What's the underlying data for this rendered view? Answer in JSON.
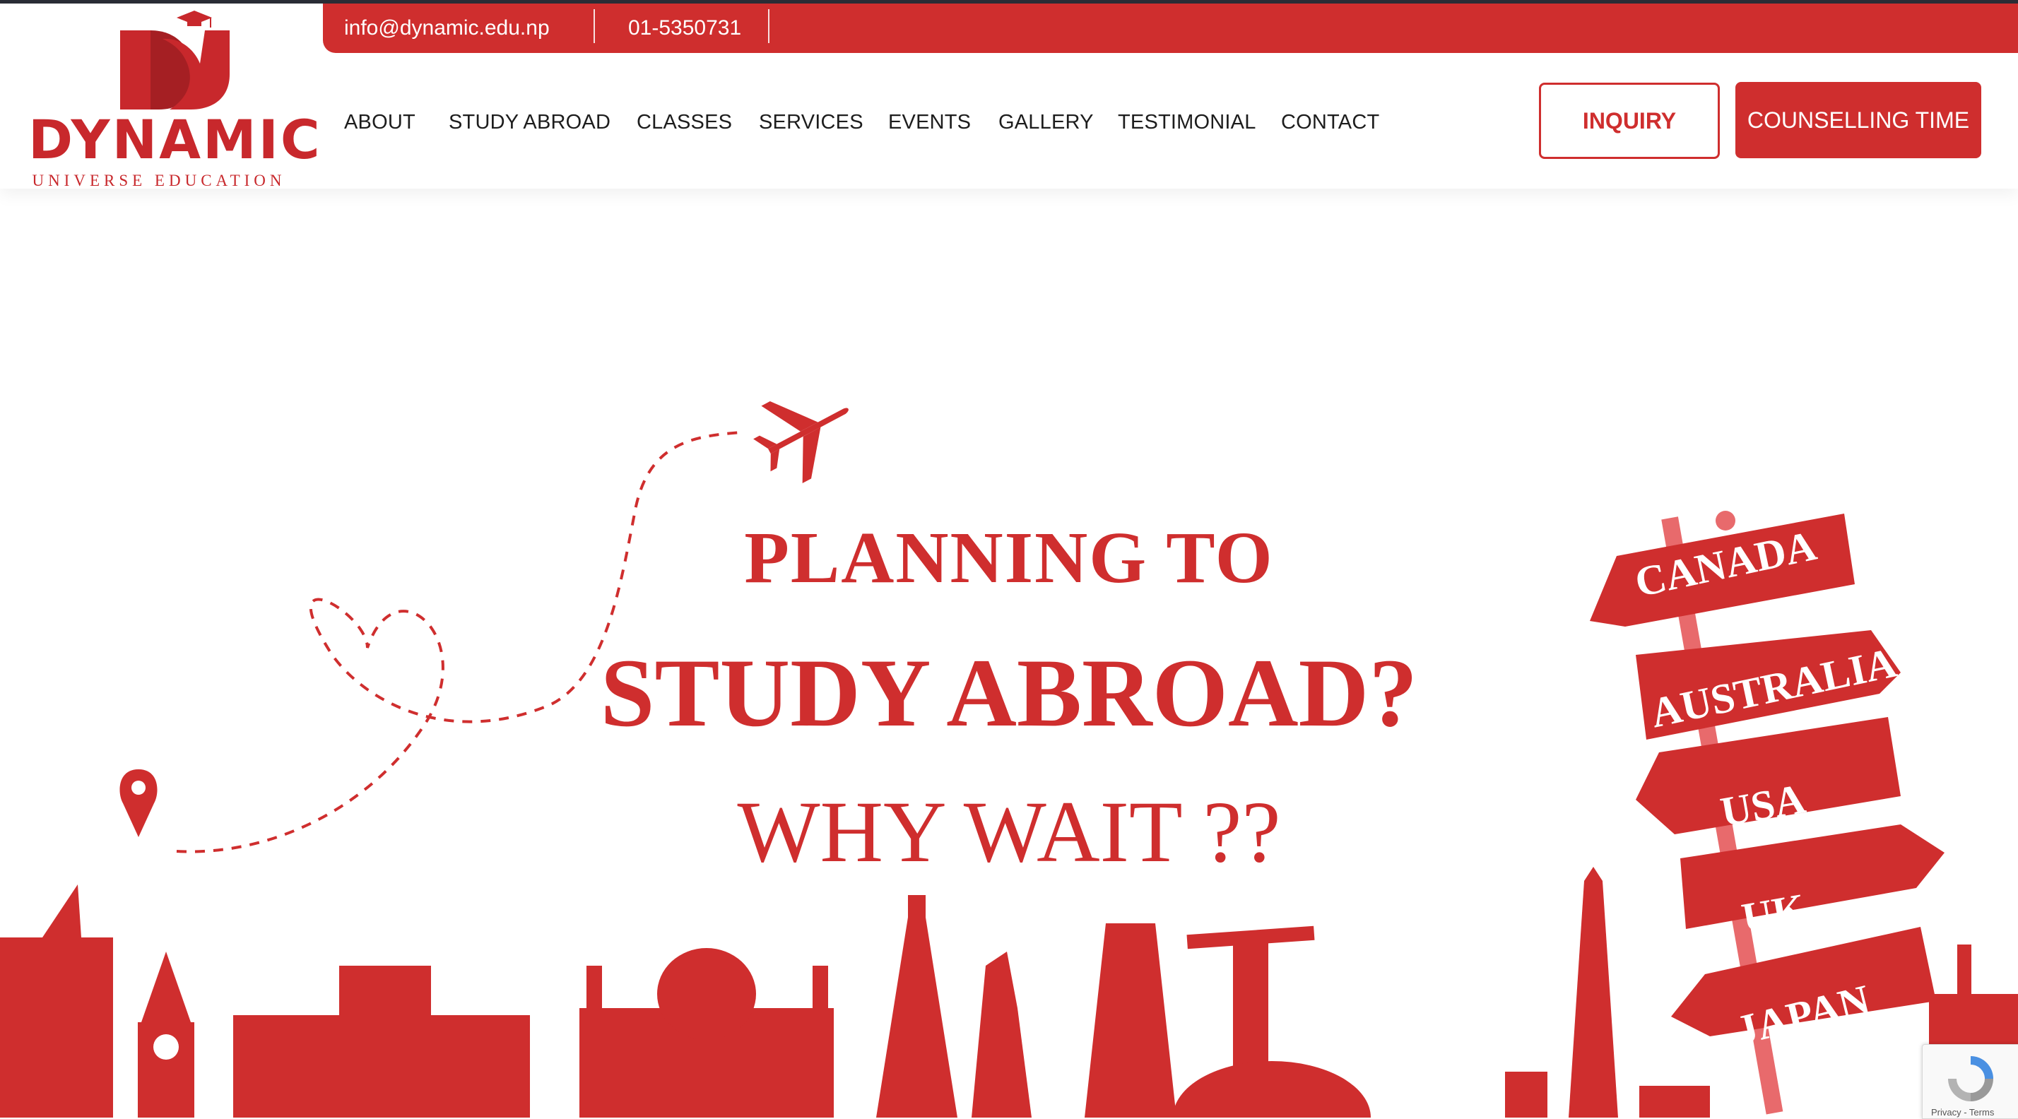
{
  "brand": {
    "name": "DYNAMIC",
    "tagline": "UNIVERSE EDUCATION",
    "color": "#cf2e2e"
  },
  "topbar": {
    "email": "info@dynamic.edu.np",
    "phone": "01-5350731"
  },
  "nav": {
    "items": [
      "ABOUT",
      "STUDY ABROAD",
      "CLASSES",
      "SERVICES",
      "EVENTS",
      "GALLERY",
      "TESTIMONIAL",
      "CONTACT"
    ]
  },
  "actions": {
    "inquiry_label": "INQUIRY",
    "counselling_label": "COUNSELLING TIME"
  },
  "hero": {
    "line1": "PLANNING TO",
    "line2": "STUDY ABROAD?",
    "line3": "WHY WAIT ??",
    "signposts": [
      "CANADA",
      "AUSTRALIA",
      "USA",
      "UK",
      "JAPAN"
    ],
    "icons": [
      "airplane-icon",
      "heart-path-icon",
      "location-pin-icon",
      "city-skyline-illustration"
    ]
  },
  "recaptcha": {
    "links": "Privacy - Terms"
  }
}
